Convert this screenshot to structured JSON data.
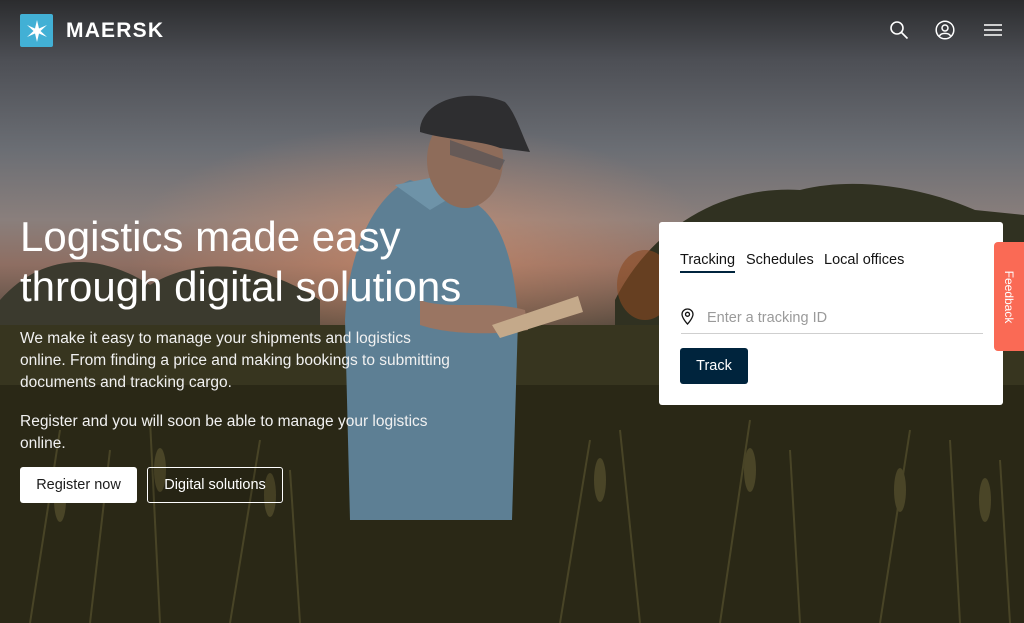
{
  "header": {
    "brand": "MAERSK",
    "icons": [
      "search-icon",
      "account-icon",
      "menu-icon"
    ]
  },
  "hero": {
    "headline": "Logistics made easy through digital solutions",
    "paragraph_1": "We make it easy to manage your shipments and logistics online. From finding a price and making bookings to submitting documents and tracking cargo.",
    "paragraph_2": "Register and you will soon be able to manage your logistics online.",
    "register_label": "Register now",
    "digital_label": "Digital solutions"
  },
  "card": {
    "tabs": [
      {
        "label": "Tracking",
        "active": true
      },
      {
        "label": "Schedules",
        "active": false
      },
      {
        "label": "Local offices",
        "active": false
      }
    ],
    "input": {
      "value": "",
      "placeholder": "Enter a tracking ID"
    },
    "track_label": "Track"
  },
  "feedback": {
    "label": "Feedback"
  },
  "colors": {
    "logo_blue": "#42b0d5",
    "navy": "#00243d",
    "feedback": "#fa6a55"
  }
}
